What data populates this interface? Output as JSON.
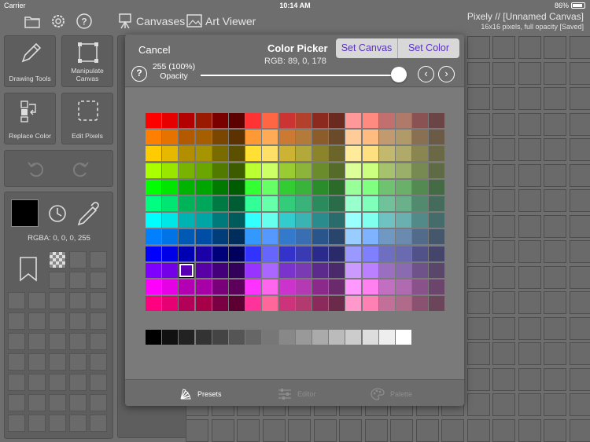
{
  "status_bar": {
    "carrier": "Carrier",
    "time": "10:14 AM",
    "battery": "86%"
  },
  "toolbar": {
    "canvases_label": "Canvases",
    "art_viewer_label": "Art Viewer",
    "app_title": "Pixely // [Unnamed Canvas]",
    "app_subtitle": "16x16 pixels, full opacity [Saved]"
  },
  "left_panel": {
    "drawing_tools_label": "Drawing Tools",
    "manipulate_canvas_label": "Manipulate Canvas",
    "replace_color_label": "Replace Color",
    "edit_pixels_label": "Edit Pixels",
    "rgba_readout": "RGBA: 0, 0, 0, 255",
    "current_color": "#000000"
  },
  "color_picker": {
    "cancel_label": "Cancel",
    "title": "Color Picker",
    "rgb_readout": "RGB: 89, 0, 178",
    "set_canvas_label": "Set Canvas",
    "set_color_label": "Set Color",
    "opacity_value": "255 (100%)",
    "opacity_label": "Opacity",
    "opacity_fraction": 1.0,
    "selected_color": "#5900b2",
    "accent_color": "#5a2fc5"
  },
  "tabs": [
    {
      "label": "Presets",
      "icon": "presets-fan-icon",
      "active": true
    },
    {
      "label": "Editor",
      "icon": "sliders-icon",
      "active": false
    },
    {
      "label": "Palette",
      "icon": "palette-icon",
      "active": false
    }
  ],
  "palette": {
    "rows": [
      [
        "#ff0000",
        "#e60000",
        "#b30000",
        "#991a00",
        "#7a0000",
        "#5c0000",
        "#ff3333",
        "#ff6644",
        "#cc3333",
        "#b3402a",
        "#8c2a1f",
        "#6b2a1f",
        "#ff9999",
        "#ff8a80",
        "#c26f6f",
        "#b07a6a",
        "#8a5252",
        "#6b4545"
      ],
      [
        "#ff8000",
        "#e67300",
        "#b35900",
        "#a65f00",
        "#7a4600",
        "#5c3300",
        "#ff9933",
        "#ffaa55",
        "#cc7a33",
        "#b37a3a",
        "#8c5c2a",
        "#6b4a2a",
        "#ffcc99",
        "#ffbb80",
        "#c29a6f",
        "#b09a6a",
        "#8a7052",
        "#6b5a45"
      ],
      [
        "#ffcc00",
        "#e6b800",
        "#b38f00",
        "#a69400",
        "#7a6b00",
        "#5c5000",
        "#ffe033",
        "#ffe066",
        "#ccb333",
        "#b3a83a",
        "#8c842a",
        "#6b652a",
        "#ffeb99",
        "#ffe080",
        "#c2b96f",
        "#b0aa6a",
        "#8a8652",
        "#6b6845"
      ],
      [
        "#aaff00",
        "#99e600",
        "#77b300",
        "#6ba600",
        "#507a00",
        "#3d5c00",
        "#bbff33",
        "#ccff66",
        "#99cc33",
        "#8cb33a",
        "#6b8c2a",
        "#556b2a",
        "#ddff99",
        "#ccff80",
        "#a7c26f",
        "#9ab06a",
        "#778a52",
        "#5e6b45"
      ],
      [
        "#00ff00",
        "#00e600",
        "#00b300",
        "#00a600",
        "#007a00",
        "#005c00",
        "#33ff33",
        "#66ff66",
        "#33cc33",
        "#3ab33a",
        "#2a8c2a",
        "#2a6b2a",
        "#99ff99",
        "#80ff80",
        "#6fc26f",
        "#6ab06a",
        "#528a52",
        "#456b45"
      ],
      [
        "#00ff80",
        "#00e673",
        "#00b359",
        "#00a659",
        "#007a43",
        "#005c33",
        "#33ff99",
        "#66ffaa",
        "#33cc7a",
        "#3ab37a",
        "#2a8c5c",
        "#2a6b4a",
        "#99ffcc",
        "#80ffbb",
        "#6fc29a",
        "#6ab08a",
        "#528a70",
        "#456b5a"
      ],
      [
        "#00ffff",
        "#00e6e6",
        "#00b3b3",
        "#00a6a6",
        "#007a7a",
        "#005c5c",
        "#33ffff",
        "#66ffee",
        "#33cccc",
        "#3ab3b3",
        "#2a8c8c",
        "#2a6b6b",
        "#99ffff",
        "#80ffee",
        "#6fc2c2",
        "#6ab0b0",
        "#528a8a",
        "#456b6b"
      ],
      [
        "#0080ff",
        "#0073e6",
        "#0059b3",
        "#004da6",
        "#003d7a",
        "#002e5c",
        "#3399ff",
        "#5599ff",
        "#337acc",
        "#3a6eb3",
        "#2a558c",
        "#2a456b",
        "#99ccff",
        "#80b3ff",
        "#6f99c2",
        "#6a8ab0",
        "#526b8a",
        "#45586b"
      ],
      [
        "#0000ff",
        "#0000e6",
        "#0000b3",
        "#1a00a6",
        "#00007a",
        "#00005c",
        "#3333ff",
        "#6666ff",
        "#3333cc",
        "#3a3ab3",
        "#2a2a8c",
        "#2a2a6b",
        "#9999ff",
        "#8080ff",
        "#6f6fc2",
        "#6a6ab0",
        "#52528a",
        "#45456b"
      ],
      [
        "#8000ff",
        "#7300e6",
        "#5900b2",
        "#5900a6",
        "#43007a",
        "#33005c",
        "#9933ff",
        "#aa66ff",
        "#7a33cc",
        "#7a3ab3",
        "#5c2a8c",
        "#4a2a6b",
        "#cc99ff",
        "#bb80ff",
        "#9a6fc2",
        "#8a6ab0",
        "#70528a",
        "#5a456b"
      ],
      [
        "#ff00ff",
        "#e600e6",
        "#b300b3",
        "#a600a6",
        "#7a007a",
        "#5c005c",
        "#ff33ff",
        "#ff66ee",
        "#cc33cc",
        "#b33ab3",
        "#8c2a8c",
        "#6b2a6b",
        "#ff99ff",
        "#ff80ee",
        "#c26fc2",
        "#b06ab0",
        "#8a528a",
        "#6b456b"
      ],
      [
        "#ff0080",
        "#e60073",
        "#b30059",
        "#a60049",
        "#7a0043",
        "#5c0033",
        "#ff3399",
        "#ff6699",
        "#cc337a",
        "#b33a6e",
        "#8c2a5c",
        "#6b2a4a",
        "#ff99cc",
        "#ff80b3",
        "#c26f99",
        "#b06a8a",
        "#8a5270",
        "#6b455a"
      ]
    ],
    "grays": [
      "#000000",
      "#111111",
      "#222222",
      "#333333",
      "#444444",
      "#555555",
      "#666666",
      "#777777",
      "#888888",
      "#999999",
      "#aaaaaa",
      "#bbbbbb",
      "#cccccc",
      "#dddddd",
      "#eeeeee",
      "#ffffff"
    ],
    "selected": {
      "row": 9,
      "col": 2
    }
  }
}
